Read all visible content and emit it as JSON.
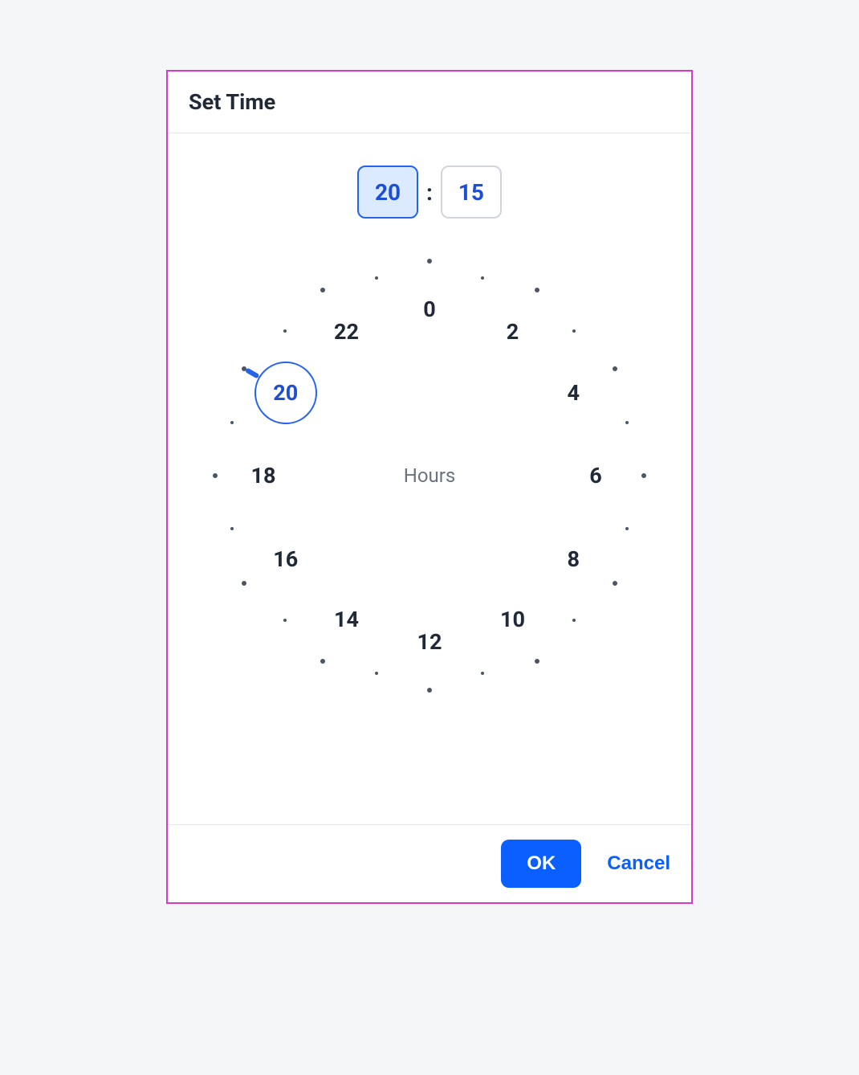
{
  "dialog": {
    "title": "Set Time",
    "selected_hours": "20",
    "selected_minutes": "15",
    "clock_center_label": "Hours",
    "selected_hour_on_clock": "20",
    "hour_labels": [
      "0",
      "2",
      "4",
      "6",
      "8",
      "10",
      "12",
      "14",
      "16",
      "18",
      "20",
      "22"
    ],
    "buttons": {
      "ok": "OK",
      "cancel": "Cancel"
    }
  },
  "colors": {
    "primary": "#0b5fff",
    "primary_border": "#2563eb",
    "primary_fill_light": "#dbeafe",
    "dialog_border": "#d63ac7"
  }
}
